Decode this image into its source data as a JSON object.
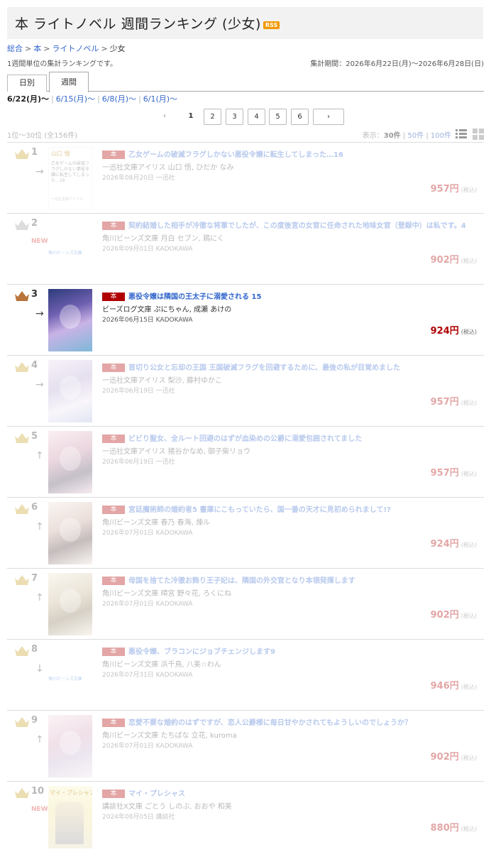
{
  "header": {
    "title": "本 ライトノベル 週間ランキング (少女)",
    "rss": "RSS"
  },
  "breadcrumb": {
    "items": [
      "総合",
      "本",
      "ライトノベル"
    ],
    "current": "少女",
    "sep": ">"
  },
  "description": "1週間単位の集計ランキングです。",
  "period": "集計期間：2026年6月22日(月)〜2026年6月28日(日)",
  "tabs": [
    "日別",
    "週間"
  ],
  "weeks": {
    "current": "6/22(月)〜",
    "links": [
      "6/15(月)〜",
      "6/8(月)〜",
      "6/1(月)〜"
    ],
    "sep": "|"
  },
  "pager": {
    "prev": "‹",
    "pages": [
      "1",
      "2",
      "3",
      "4",
      "5",
      "6"
    ],
    "next": "›",
    "current": "1"
  },
  "list": {
    "count": "1位〜30位 (全156件)",
    "display_label": "表示：",
    "display_current": "30件",
    "display_options": [
      "50件",
      "100件"
    ],
    "display_sep": "|"
  },
  "colors": {
    "link": "#3366cc",
    "price": "#b00000",
    "badge": "#b00000",
    "new": "#e03030",
    "crown_gold": "#c9a227",
    "crown_silver": "#a0a0a0",
    "crown_bronze": "#b8743a"
  },
  "items": [
    {
      "rank": "1",
      "move": "→",
      "badge": "本",
      "title": "乙女ゲームの破滅フラグしかない悪役令嬢に転生してしまった…16",
      "label": "一迅社文庫アイリス 山口 悟, ひだか なみ",
      "date_pub": "2026年08月20日 一迅社",
      "price": "957円",
      "tax": "(税込)",
      "cover_text": [
        "山口 悟",
        "乙女ゲームの破滅フラグしかない悪役令嬢に転生してしまった…16",
        "一迅社文庫アイリス"
      ]
    },
    {
      "rank": "2",
      "new": "NEW",
      "badge": "本",
      "title": "契約結婚した相手が冷徹な将軍でしたが、この度後宮の女官に任命された地味女官（登録中）は私です。4",
      "label": "角川ビーンズ文庫 月白 セブン, 鶏にく",
      "date_pub": "2026年09月01日 KADOKAWA",
      "price": "902円",
      "tax": "(税込)",
      "cover_text": [
        "角川ビーンズ文庫"
      ]
    },
    {
      "rank": "3",
      "move": "→",
      "badge": "本",
      "title": "悪役令嬢は隣国の王太子に溺愛される 15",
      "label": "ビーズログ文庫 ぷにちゃん, 成瀬 あけの",
      "date_pub": "2026年06月15日 KADOKAWA",
      "price": "924円",
      "tax": "(税込)"
    },
    {
      "rank": "4",
      "move": "→",
      "badge": "本",
      "title": "首切り公女と忘却の王国 王国破滅フラグを回避するために、最後の私が目覚めました",
      "label": "一迅社文庫アイリス 梨沙, 藤村ゆかこ",
      "date_pub": "2026年06月19日 一迅社",
      "price": "957円",
      "tax": "(税込)"
    },
    {
      "rank": "5",
      "move": "↑",
      "badge": "本",
      "title": "ビビり聖女、全ルート回避のはずが血染めの公爵に溺愛包囲されてました",
      "label": "一迅社文庫アイリス 猪谷かなめ, 御子柴リョウ",
      "date_pub": "2026年06月19日 一迅社",
      "price": "957円",
      "tax": "(税込)"
    },
    {
      "rank": "6",
      "move": "↑",
      "badge": "本",
      "title": "宮廷魔術師の婚約者5 書庫にこもっていたら、国一番の天才に見初められまして!?",
      "label": "角川ビーンズ文庫 春乃 春海, 煉ル",
      "date_pub": "2026年07月01日 KADOKAWA",
      "price": "924円",
      "tax": "(税込)"
    },
    {
      "rank": "7",
      "move": "↑",
      "badge": "本",
      "title": "母国を捨てた冷徹お飾り王子妃は、隣国の外交官となり本領発揮します",
      "label": "角川ビーンズ文庫 晴宮 野々花, ろくにね",
      "date_pub": "2026年07月01日 KADOKAWA",
      "price": "902円",
      "tax": "(税込)"
    },
    {
      "rank": "8",
      "move": "↓",
      "badge": "本",
      "title": "悪役令嬢、ブラコンにジョブチェンジします9",
      "label": "角川ビーンズ文庫 浜千鳥, 八美☆わん",
      "date_pub": "2026年07月31日 KADOKAWA",
      "price": "946円",
      "tax": "(税込)",
      "cover_text": [
        "角川ビーンズ文庫"
      ]
    },
    {
      "rank": "9",
      "move": "↑",
      "badge": "本",
      "title": "恋愛不要な婚約のはずですが、恋人公爵様に毎日甘やかされてもようしいのでしょうか？",
      "label": "角川ビーンズ文庫 たちばな 立花, kuroma",
      "date_pub": "2026年07月01日 KADOKAWA",
      "price": "902円",
      "tax": "(税込)"
    },
    {
      "rank": "10",
      "new": "NEW",
      "badge": "本",
      "title": "マイ・プレシャス",
      "label": "講談社X文庫 ごとう しのぶ, おおや 和美",
      "date_pub": "2024年08月05日 講談社",
      "price": "880円",
      "tax": "(税込)",
      "cover_text": [
        "マイ・プレシャス"
      ]
    }
  ]
}
